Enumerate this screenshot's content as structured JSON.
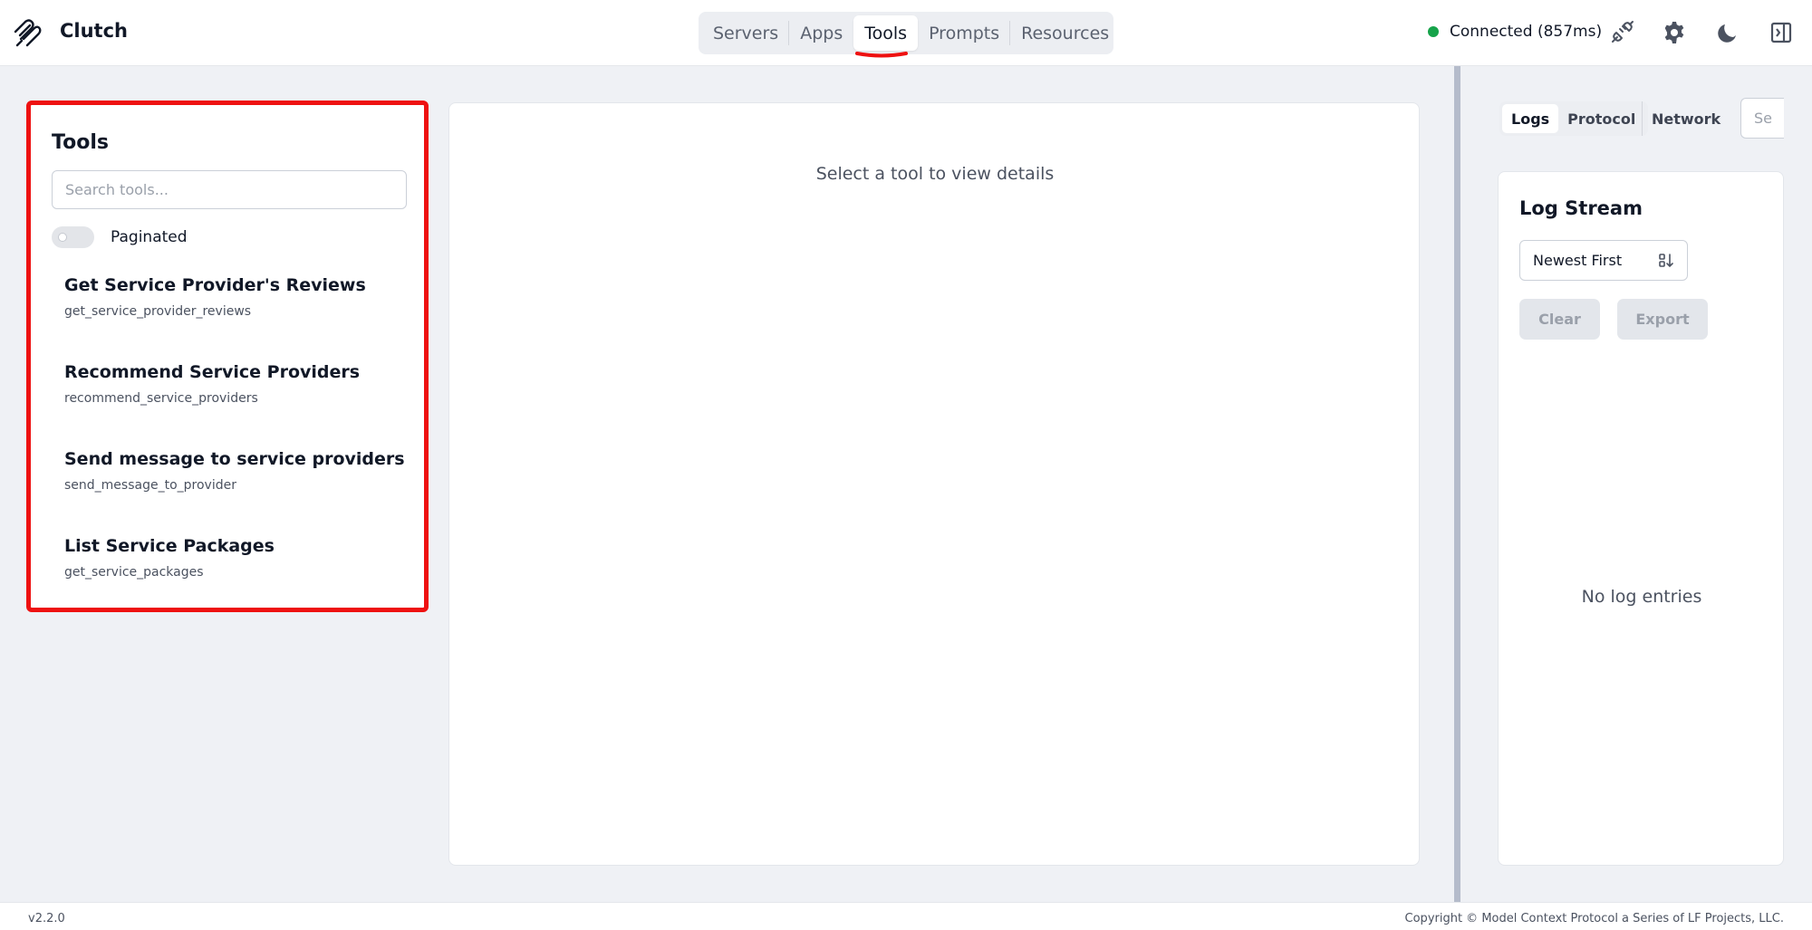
{
  "header": {
    "app_title": "Clutch",
    "nav_tabs": [
      "Servers",
      "Apps",
      "Tools",
      "Prompts",
      "Resources"
    ],
    "active_tab": "Tools",
    "connection_status": "Connected (857ms)",
    "status_color": "#16a34a",
    "accent_color": "#ee1111",
    "icons": [
      "clutch-logo-icon",
      "plug-icon",
      "gear-icon",
      "moon-icon",
      "sidebar-toggle-icon"
    ]
  },
  "tools_panel": {
    "title": "Tools",
    "search_placeholder": "Search tools...",
    "paginated_label": "Paginated",
    "paginated_enabled": false,
    "tools": [
      {
        "name": "Get Service Provider's Reviews",
        "id": "get_service_provider_reviews"
      },
      {
        "name": "Recommend Service Providers",
        "id": "recommend_service_providers"
      },
      {
        "name": "Send message to service providers",
        "id": "send_message_to_provider"
      },
      {
        "name": "List Service Packages",
        "id": "get_service_packages"
      }
    ]
  },
  "detail_panel": {
    "empty_message": "Select a tool to view details"
  },
  "log_sidebar": {
    "tabs": [
      "Logs",
      "Protocol",
      "Network"
    ],
    "active_tab": "Logs",
    "search_placeholder": "Se",
    "title": "Log Stream",
    "sort_value": "Newest First",
    "clear_label": "Clear",
    "export_label": "Export",
    "empty_message": "No log entries"
  },
  "footer": {
    "version": "v2.2.0",
    "copyright": "Copyright © Model Context Protocol a Series of LF Projects, LLC."
  }
}
